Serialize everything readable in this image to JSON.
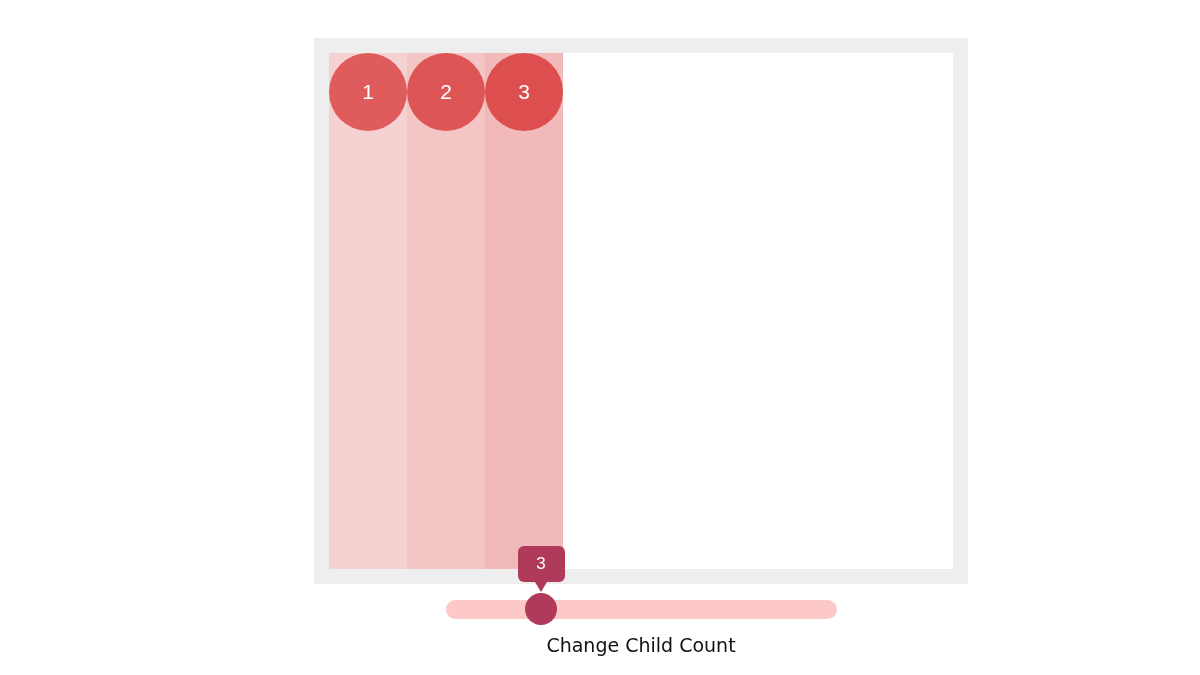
{
  "children": [
    {
      "label": "1",
      "color": "#e05c5c"
    },
    {
      "label": "2",
      "color": "#de5555"
    },
    {
      "label": "3",
      "color": "#dd4f4f"
    }
  ],
  "slider": {
    "value": "3",
    "level": 0.243,
    "label": "Change Child Count"
  }
}
